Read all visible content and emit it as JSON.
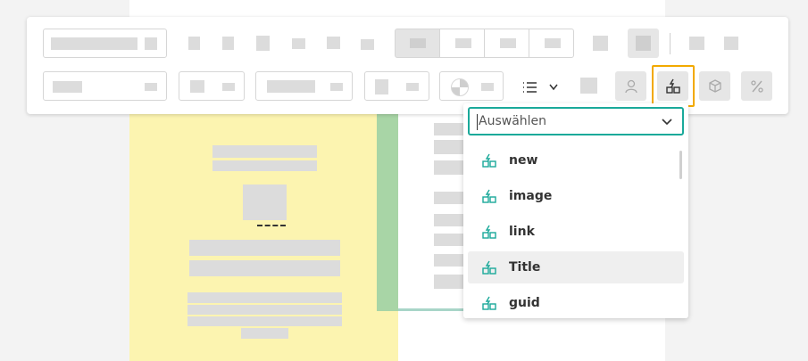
{
  "dropdown": {
    "placeholder": "Auswählen",
    "options": [
      {
        "label": "new"
      },
      {
        "label": "image"
      },
      {
        "label": "link"
      },
      {
        "label": "Title"
      },
      {
        "label": "guid"
      }
    ]
  },
  "colors": {
    "accent": "#1aa99a",
    "highlight": "#f2a900",
    "note_yellow": "#fcf4b0",
    "green_bar": "#a8d5a6"
  }
}
